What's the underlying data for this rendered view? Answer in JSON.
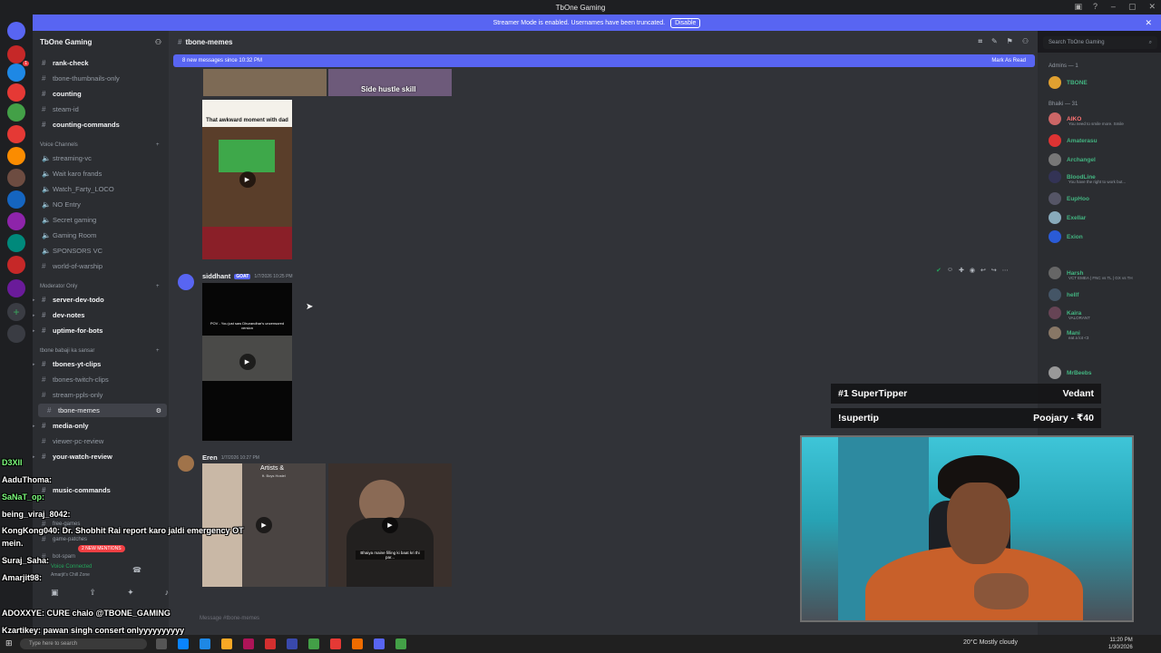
{
  "window": {
    "title": "TbOne Gaming"
  },
  "streamer_bar": {
    "text": "Streamer Mode is enabled. Usernames have been truncated.",
    "disable_label": "Disable"
  },
  "server": {
    "name": "TbOne Gaming"
  },
  "channels": {
    "rank_check": "rank-check",
    "thumbnails_only": "tbone-thumbnails-only",
    "counting": "counting",
    "steam_id": "steam-id",
    "counting_commands": "counting-commands",
    "cat_voice": "Voice Channels",
    "streaming_vc": "streaming-vc",
    "wait_karo": "Wait karo frands",
    "watch_farty": "Watch_Farty_LOCO",
    "no_entry": "NO Entry",
    "secret_gaming": "Secret gaming",
    "gaming_room": "Gaming Room",
    "sponsors_vc": "SPONSORS VC",
    "world_of_warship": "world-of-warship",
    "cat_moderator": "Moderator Only",
    "server_dev_todo": "server-dev-todo",
    "dev_notes": "dev-notes",
    "uptime_for_bots": "uptime-for-bots",
    "cat_tbone_babaji": "tbone babaji ka sansar",
    "tbones_yt_clips": "tbones-yt-clips",
    "tbones_twitch_clips": "tbones-twitch-clips",
    "stream_ppls_only": "stream-ppls-only",
    "tbone_memes": "tbone-memes",
    "media_only": "media-only",
    "viewer_pc_review": "viewer-pc-review",
    "your_watch_review": "your-watch-review",
    "music_commands": "music-commands",
    "free_games": "free-games",
    "game_patches": "game-patches",
    "bot_spam": "bot-spam",
    "mentions_badge": "2 NEW MENTIONS"
  },
  "voice": {
    "status": "Voice Connected",
    "channel": "Amarjit's Chill Zone"
  },
  "header": {
    "channel": "tbone-memes"
  },
  "new_messages": {
    "text": "8 new messages since 10:32 PM",
    "mark_read": "Mark As Read"
  },
  "messages": {
    "top_caption": "Side hustle skill",
    "awkward_caption": "That awkward moment with dad",
    "m2_author": "siddhant",
    "m2_tag": "GOAT",
    "m2_time": "1/7/2026 10:25 PM",
    "m2_video_text": "POV - You just saw Dhurandhar's uncensored version",
    "m3_author": "Eren",
    "m3_time": "1/7/2026 10:27 PM",
    "m3_img_text": "Artists &",
    "m3_img_subtext": "ft. Boys Hostel",
    "m3_img2_text": "Bhaiya maine filling ki baat kri thi par..."
  },
  "composer": {
    "placeholder": "Message #tbone-memes"
  },
  "search": {
    "placeholder": "Search TbOne Gaming"
  },
  "members": {
    "admins_head": "Admins — 1",
    "tbone": "TBONE",
    "bhaiki_head": "Bhaiki — 31",
    "aiko": "AIKO",
    "aiko_sub": "You need to smile more. Smile",
    "amaterasu": "Amaterasu",
    "archangel": "Archangel",
    "bloodline": "BloodLine",
    "bloodline_sub": "You have the right to work but...",
    "euphoo": "EupHoo",
    "exellar": "Exellar",
    "exion": "Exion",
    "harsh": "Harsh",
    "harsh_sub": "VCT EMEA | FNC vs TL | GX vs TH",
    "hellf": "hellf",
    "kaira": "Kaira",
    "kaira_sub": "VALORANT",
    "mani": "Mani",
    "mani_sub": "eat a lot <3",
    "mrbeebs": "MrBeebs"
  },
  "stream_overlay": {
    "tipper_label": "#1 SuperTipper",
    "tipper_name": "Vedant",
    "supertip_label": "!supertip",
    "supertip_value": "Poojary - ₹40"
  },
  "chat": [
    {
      "user": "D3XII",
      "text": ""
    },
    {
      "user": "AaduThoma:",
      "text": ""
    },
    {
      "user": "SaNaT_op:",
      "text": ""
    },
    {
      "user": "being_viraj_8042:",
      "text": ""
    },
    {
      "user": "KongKong040:",
      "text": "Dr. Shobhit Rai report karo jaldi emergency OT"
    },
    {
      "user": "",
      "text": "mein."
    },
    {
      "user": "Suraj_Saha:",
      "text": ""
    },
    {
      "user": "Amarjit98:",
      "text": ""
    },
    {
      "user": "ADOXXYE:",
      "text": "CURE chalo @TBONE_GAMING"
    },
    {
      "user": "Kzartikey:",
      "text": "pawan singh consert onlyyyyyyyyyy"
    }
  ],
  "taskbar": {
    "search": "Type here to search",
    "weather": "20°C  Mostly cloudy",
    "time": "11:20 PM",
    "date": "1/30/2026"
  },
  "colors": {
    "accent": "#5865f2",
    "sidebar": "#2b2d31",
    "chat_bg": "#313338",
    "rail": "#1e1f22"
  }
}
